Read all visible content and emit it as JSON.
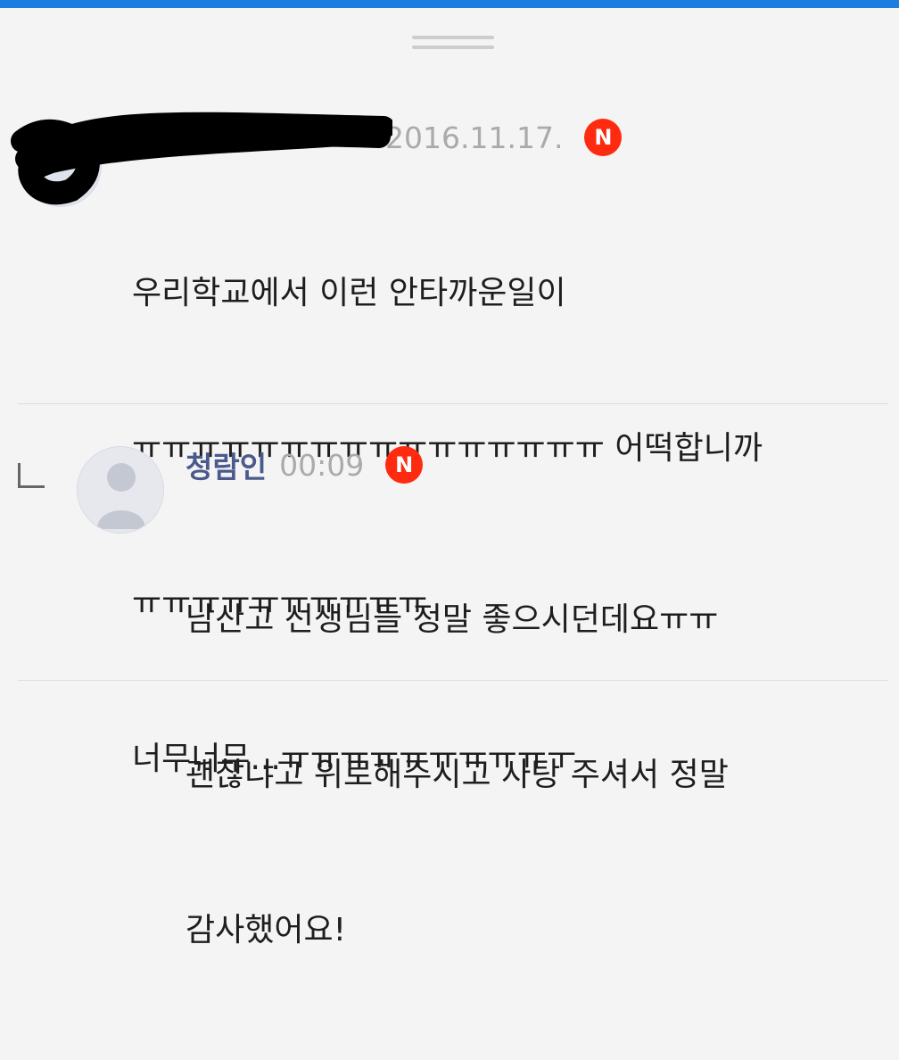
{
  "comments": [
    {
      "author": "",
      "time": "2016.11.17.",
      "badge": "N",
      "lines": [
        "우리학교에서 이런 안타까운일이",
        "ㅠㅠㅠㅠㅠㅠㅠㅠㅠㅠㅠㅠㅠㅠㅠㅠ 어떡합니까",
        "ㅠㅠㅠㅠㅠㅠㅠㅠㅠㅠ",
        "너무너무...ㅠㅠㅠㅠㅠㅠㅠㅠㅠㅜ"
      ]
    },
    {
      "author": "청람인",
      "time": "00:09",
      "badge": "N",
      "lines": [
        "남산고 선생님들 정말 좋으시던데요ㅠㅠ",
        "괜찮냐고 위로해주시고 사탕 주셔서 정말",
        "감사했어요!"
      ]
    }
  ],
  "colors": {
    "topbar": "#1a7ee0",
    "author": "#4b5a8c",
    "badge": "#ff2b10",
    "time": "#aaaaaa"
  },
  "icons": [
    "drag-handle-icon",
    "new-badge-icon",
    "reply-arrow-icon",
    "default-avatar-icon"
  ]
}
